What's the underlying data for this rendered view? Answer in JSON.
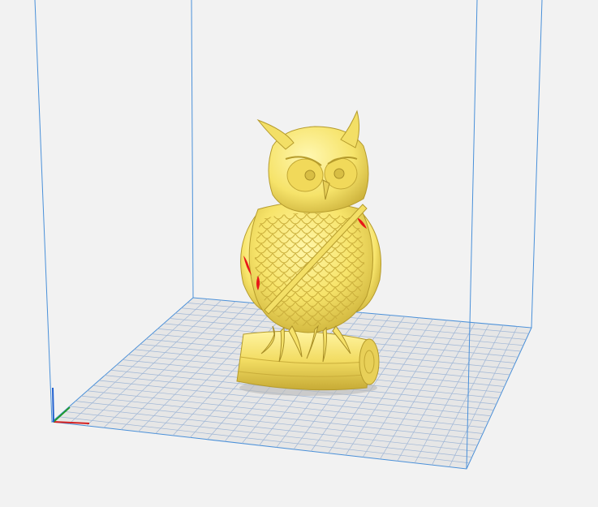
{
  "viewport": {
    "background": "#f2f2f2",
    "build_volume_edge_color": "#4a90d9",
    "grid_color": "#9fb6d6",
    "plate_color": "#e6e6e6"
  },
  "axes": {
    "x_color": "#d62020",
    "y_color": "#1f9a2e",
    "z_color": "#2060d0"
  },
  "model": {
    "subject": "owl-on-log",
    "color": "#f7e46a",
    "shade_color": "#d9c24a",
    "overhang_color": "#e81818"
  }
}
